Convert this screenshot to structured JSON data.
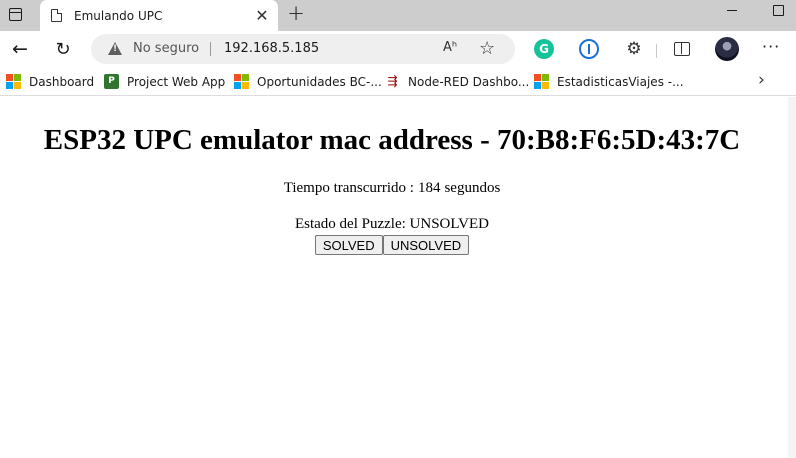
{
  "browser": {
    "tab": {
      "title": "Emulando UPC"
    },
    "address": {
      "security_label": "No seguro",
      "url": "192.168.5.185"
    },
    "icons": {
      "tab_actions": "tab-actions-icon",
      "page": "page-icon",
      "back": "back-arrow-icon",
      "reload": "reload-icon",
      "warning": "warning-triangle-icon",
      "read_aloud": "read-aloud-icon",
      "favorite": "star-icon",
      "grammarly": "grammarly-icon",
      "password_manager": "1password-icon",
      "extensions": "puzzle-icon",
      "split_screen": "split-screen-icon",
      "more": "more-icon"
    },
    "read_aloud_glyph": "Aʰ",
    "grammarly_glyph": "G",
    "more_glyph": "···"
  },
  "bookmarks": [
    {
      "label": "Dashboard",
      "icon": "microsoft-icon"
    },
    {
      "label": "Project Web App",
      "icon": "project-icon"
    },
    {
      "label": "Oportunidades BC-...",
      "icon": "microsoft-icon"
    },
    {
      "label": "Node-RED Dashbo...",
      "icon": "node-red-icon"
    },
    {
      "label": "EstadisticasViajes -...",
      "icon": "microsoft-icon"
    }
  ],
  "page": {
    "heading": "ESP32 UPC emulator mac address - 70:B8:F6:5D:43:7C",
    "elapsed_prefix": "Tiempo transcurrido :",
    "elapsed_value": "184",
    "elapsed_unit": "segundos",
    "state_label": "Estado del Puzzle:",
    "state_value": "UNSOLVED",
    "buttons": {
      "solved": "SOLVED",
      "unsolved": "UNSOLVED"
    }
  },
  "colors": {
    "tabstrip": "#cdcdcd",
    "addressbar": "#efefef",
    "grammarly": "#15c39a",
    "password_manager": "#1a6fd8"
  }
}
